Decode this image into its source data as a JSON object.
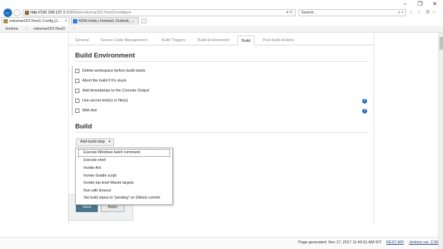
{
  "window": {
    "minimize_glyph": "–",
    "maximize_glyph": "❐",
    "close_glyph": "✕"
  },
  "browser": {
    "back_glyph": "←",
    "forward_glyph": "→",
    "url_host": "http://192.168.137.1",
    "url_rest": ":8080/job/vskumar2017test1/configure",
    "address_tools": "▾ ⟳",
    "search_placeholder": "Search...",
    "search_glyph": "⌕ ▾",
    "toolbar_icons": "⌂ ☆ ⚙",
    "smiley_glyph": "☺",
    "tabs": [
      {
        "label": "vskumar2017test1 Config [J...",
        "close": "×"
      },
      {
        "label": "MSN India | Hotmail, Outlook, ...",
        "close": ""
      }
    ]
  },
  "breadcrumb": {
    "items": [
      "Jenkins",
      "vskumar2017test1"
    ],
    "sep": "»"
  },
  "config_tabs": [
    "General",
    "Source Code Management",
    "Build Triggers",
    "Build Environment",
    "Build",
    "Post-build Actions"
  ],
  "build_environment": {
    "title": "Build Environment",
    "options": [
      "Delete workspace before build starts",
      "Abort the build if it's stuck",
      "Add timestamps to the Console Output",
      "Use secret text(s) or file(s)",
      "With Ant"
    ],
    "help_glyph": "?"
  },
  "build": {
    "title": "Build",
    "add_step_label": "Add build step",
    "caret": "▾",
    "menu": [
      "Execute Windows batch command",
      "Execute shell",
      "Invoke Ant",
      "Invoke Gradle script",
      "Invoke top-level Maven targets",
      "Run with timeout",
      "Set build status to \"pending\" on GitHub commit"
    ]
  },
  "actions": {
    "save": "Save",
    "apply": "Apply"
  },
  "footer": {
    "generated": "Page generated: Nov 17, 2017 11:45:51 AM IST",
    "rest_api": "REST API",
    "version": "Jenkins ver. 2.90"
  }
}
